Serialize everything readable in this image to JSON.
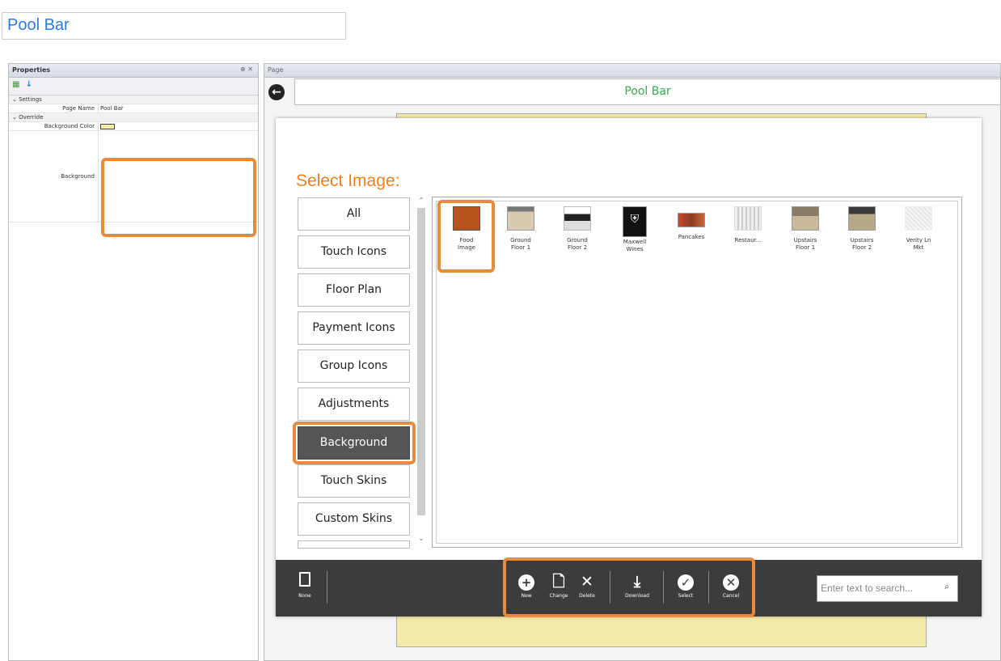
{
  "header": {
    "title": "Pool Bar"
  },
  "properties": {
    "title": "Properties",
    "pin": "⊕ ✕",
    "settings_label": "Settings",
    "page_name_label": "Page Name",
    "page_name_value": "Pool Bar",
    "override_label": "Override",
    "bgcolor_label": "Background Color",
    "background_label": "Background"
  },
  "page": {
    "pane_title": "Page",
    "title": "Pool Bar",
    "back_icon": "arrow-left-icon"
  },
  "dialog": {
    "title": "Select Image:",
    "categories": [
      "All",
      "Touch Icons",
      "Floor Plan",
      "Payment Icons",
      "Group Icons",
      "Adjustments",
      "Background",
      "Touch Skins",
      "Custom Skins"
    ],
    "selected_category": "Background",
    "images": [
      {
        "label": "Food Image",
        "line1": "Food",
        "line2": "Image"
      },
      {
        "label": "Ground Floor 1",
        "line1": "Ground",
        "line2": "Floor 1"
      },
      {
        "label": "Ground Floor 2",
        "line1": "Ground",
        "line2": "Floor 2"
      },
      {
        "label": "Maxwell Wines",
        "line1": "Maxwell",
        "line2": "Wines"
      },
      {
        "label": "Pancakes",
        "line1": "Pancakes",
        "line2": ""
      },
      {
        "label": "Restaur...",
        "line1": "Restaur...",
        "line2": ""
      },
      {
        "label": "Upstairs Floor 1",
        "line1": "Upstairs",
        "line2": "Floor 1"
      },
      {
        "label": "Upstairs Floor 2",
        "line1": "Upstairs",
        "line2": "Floor 2"
      },
      {
        "label": "Verity Ln Mkt",
        "line1": "Verity Ln",
        "line2": "Mkt"
      }
    ],
    "toolbar": {
      "none": "None",
      "new": "New",
      "change": "Change",
      "delete": "Delete",
      "download": "Download",
      "select": "Select",
      "cancel": "Cancel",
      "search_placeholder": "Enter text to search..."
    }
  },
  "colors": {
    "accent": "#f07f1e",
    "highlight": "#e98a3d",
    "title_green": "#3aa84e",
    "toolbar_bg": "#3c3c3c"
  }
}
